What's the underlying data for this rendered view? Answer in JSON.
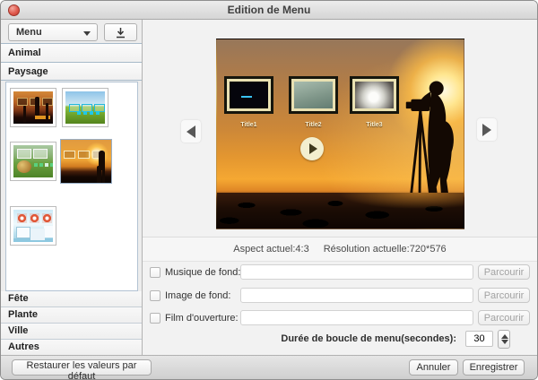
{
  "window": {
    "title": "Edition de Menu"
  },
  "sidebar": {
    "menu_dropdown": {
      "value": "Menu"
    },
    "categories_top": [
      "Animal",
      "Paysage"
    ],
    "thumbnails": [
      {
        "id": "desert-sunset-frames",
        "selected": false
      },
      {
        "id": "green-field-frames",
        "selected": false
      },
      {
        "id": "hay-bale-frames",
        "selected": false
      },
      {
        "id": "photographer-sunset-frames",
        "selected": true
      },
      {
        "id": "winter-snow-frames",
        "selected": false
      }
    ],
    "categories_bottom": [
      "Fête",
      "Plante",
      "Ville",
      "Autres"
    ]
  },
  "preview": {
    "frame_labels": [
      "Title1",
      "Title2",
      "Title3"
    ]
  },
  "info": {
    "aspect": "Aspect actuel:4:3",
    "resolution": "Résolution actuelle:720*576"
  },
  "form": {
    "rows": [
      {
        "label": "Musique de fond:",
        "checked": false,
        "value": "",
        "button": "Parcourir"
      },
      {
        "label": "Image de fond:",
        "checked": false,
        "value": "",
        "button": "Parcourir"
      },
      {
        "label": "Film d'ouverture:",
        "checked": false,
        "value": "",
        "button": "Parcourir"
      }
    ],
    "loop": {
      "label": "Durée de boucle de menu(secondes):",
      "value": "30"
    }
  },
  "footer": {
    "restore": "Restaurer les valeurs par défaut",
    "cancel": "Annuler",
    "save": "Enregistrer"
  },
  "colors": {
    "sunset_orange": "#f0a030",
    "frame_mat": "#e9e1b2",
    "panel_border": "#b2c2d2"
  }
}
